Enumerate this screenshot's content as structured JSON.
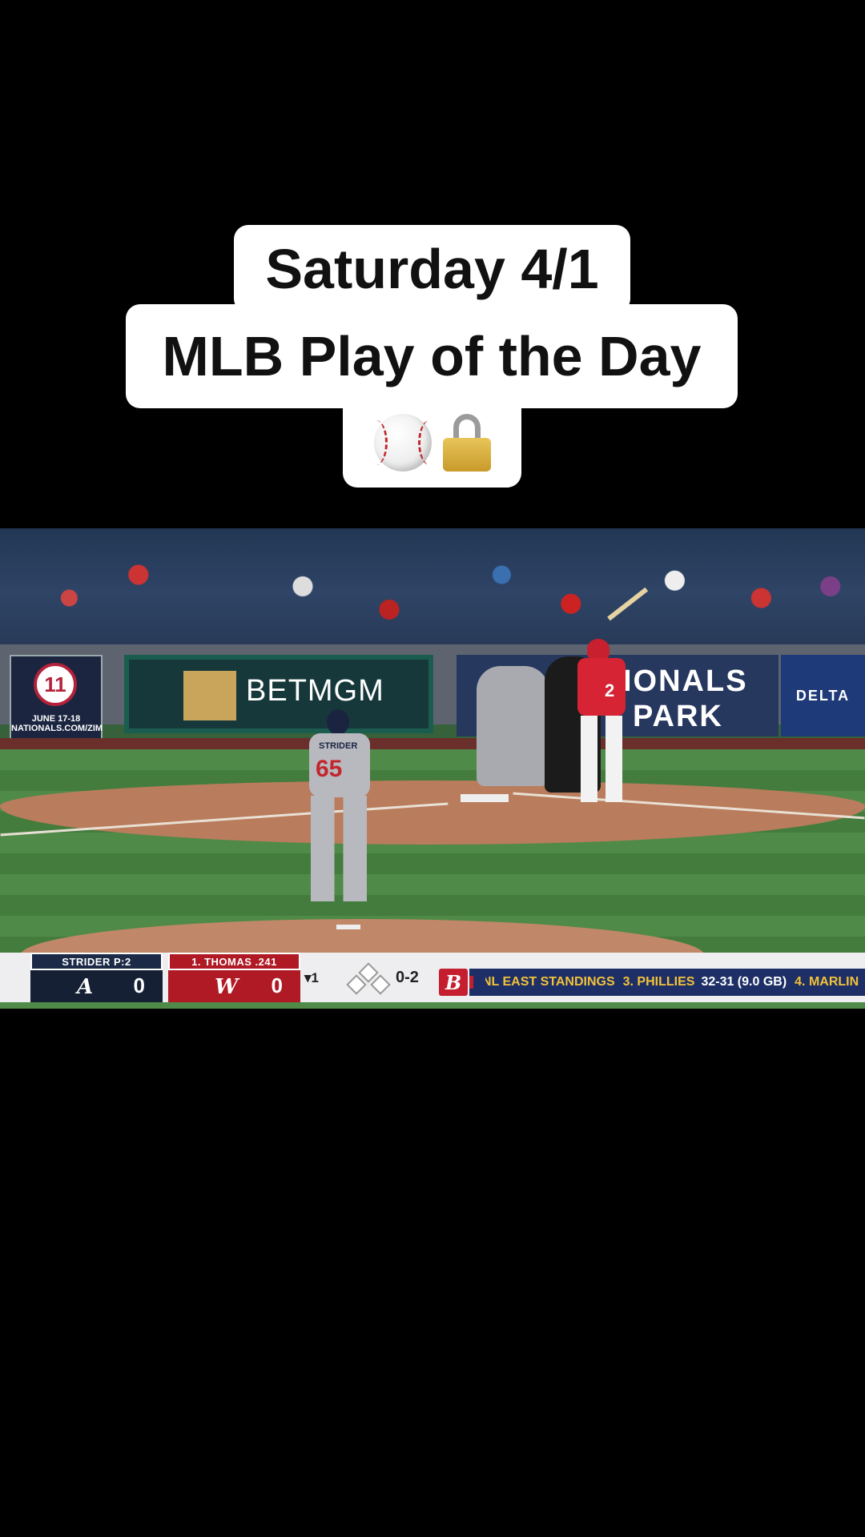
{
  "caption": {
    "line1": "Saturday 4/1",
    "line2": "MLB Play of the Day",
    "emojis": [
      "baseball-icon",
      "lock-icon"
    ]
  },
  "video": {
    "ads": {
      "anniversary_number": "11",
      "anniversary_text": "JUNE 17-18",
      "anniversary_url": "NATIONALS.COM/ZIM",
      "sponsor": "BETMGM",
      "park_line1": "IONALS",
      "park_line2": "PARK",
      "delta": "DELTA"
    },
    "pitcher_name": "STRIDER",
    "pitcher_number": "65",
    "batter_number": "2"
  },
  "scorebug": {
    "away": {
      "header": "STRIDER P:2",
      "logo": "A",
      "score": "0",
      "color": "#162035"
    },
    "home": {
      "header": "1. THOMAS .241",
      "logo": "W",
      "score": "0",
      "color": "#b01a25"
    },
    "inning": "▾1",
    "count": "0-2",
    "sponsor_mark": "B",
    "ticker": {
      "label": "NL EAST STANDINGS",
      "items": [
        {
          "team": "3. PHILLIES",
          "record": "32-31 (9.0 GB)"
        },
        {
          "team": "4. MARLIN",
          "record": ""
        }
      ]
    }
  }
}
